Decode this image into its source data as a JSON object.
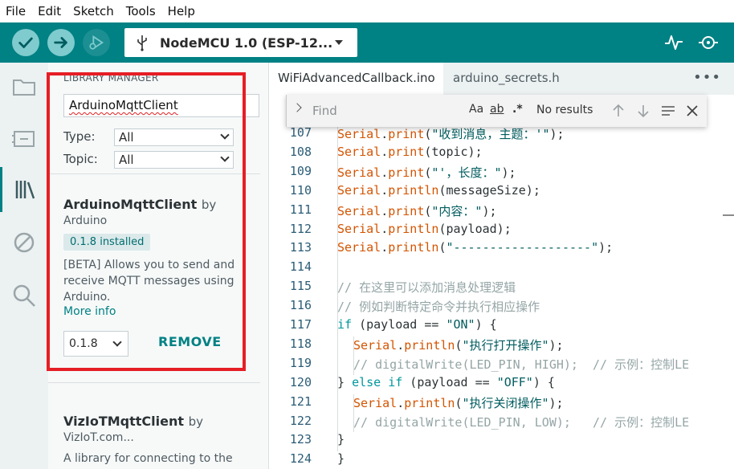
{
  "menu": [
    "File",
    "Edit",
    "Sketch",
    "Tools",
    "Help"
  ],
  "toolbar": {
    "board": "NodeMCU 1.0 (ESP-12...",
    "colors": {
      "bar": "#008184",
      "button": "#7fcbcd"
    }
  },
  "library": {
    "title": "LIBRARY MANAGER",
    "search_value": "ArduinoMqttClient",
    "type_label": "Type:",
    "type_value": "All",
    "topic_label": "Topic:",
    "topic_value": "All",
    "items": [
      {
        "name": "ArduinoMqttClient",
        "by": "by",
        "author": "Arduino",
        "installed": "0.1.8 installed",
        "description": "[BETA] Allows you to send and receive MQTT messages using Arduino.",
        "more_info": "More info",
        "version": "0.1.8",
        "action": "REMOVE"
      },
      {
        "name": "VizIoTMqttClient",
        "by": "by",
        "author": "VizIoT.com...",
        "description": "A library for connecting to the"
      }
    ]
  },
  "tabs": [
    {
      "label": "WiFiAdvancedCallback.ino",
      "active": true
    },
    {
      "label": "arduino_secrets.h",
      "active": false
    }
  ],
  "find": {
    "placeholder": "Find",
    "match_case": "Aa",
    "whole_word": "ab",
    "regex": ".*",
    "results": "No results"
  },
  "code": {
    "lines": [
      {
        "n": "107",
        "indent": 1,
        "parts": [
          [
            "fn",
            "Serial"
          ],
          [
            "p",
            "."
          ],
          [
            "fn",
            "print"
          ],
          [
            "p",
            "("
          ],
          [
            "str",
            "\"收到消息，主题：'\""
          ],
          [
            "p",
            ");"
          ]
        ]
      },
      {
        "n": "108",
        "indent": 1,
        "parts": [
          [
            "fn",
            "Serial"
          ],
          [
            "p",
            "."
          ],
          [
            "fn",
            "print"
          ],
          [
            "p",
            "(topic);"
          ]
        ]
      },
      {
        "n": "109",
        "indent": 1,
        "parts": [
          [
            "fn",
            "Serial"
          ],
          [
            "p",
            "."
          ],
          [
            "fn",
            "print"
          ],
          [
            "p",
            "("
          ],
          [
            "str",
            "\"'，长度：\""
          ],
          [
            "p",
            ");"
          ]
        ]
      },
      {
        "n": "110",
        "indent": 1,
        "parts": [
          [
            "fn",
            "Serial"
          ],
          [
            "p",
            "."
          ],
          [
            "fn",
            "println"
          ],
          [
            "p",
            "(messageSize);"
          ]
        ]
      },
      {
        "n": "111",
        "indent": 1,
        "parts": [
          [
            "fn",
            "Serial"
          ],
          [
            "p",
            "."
          ],
          [
            "fn",
            "print"
          ],
          [
            "p",
            "("
          ],
          [
            "str",
            "\"内容：\""
          ],
          [
            "p",
            ");"
          ]
        ]
      },
      {
        "n": "112",
        "indent": 1,
        "parts": [
          [
            "fn",
            "Serial"
          ],
          [
            "p",
            "."
          ],
          [
            "fn",
            "println"
          ],
          [
            "p",
            "(payload);"
          ]
        ]
      },
      {
        "n": "113",
        "indent": 1,
        "parts": [
          [
            "fn",
            "Serial"
          ],
          [
            "p",
            "."
          ],
          [
            "fn",
            "println"
          ],
          [
            "p",
            "("
          ],
          [
            "str",
            "\"-------------------\""
          ],
          [
            "p",
            ");"
          ]
        ]
      },
      {
        "n": "114",
        "indent": 1,
        "parts": []
      },
      {
        "n": "115",
        "indent": 1,
        "parts": [
          [
            "cm",
            "// 在这里可以添加消息处理逻辑"
          ]
        ]
      },
      {
        "n": "116",
        "indent": 1,
        "parts": [
          [
            "cm",
            "// 例如判断特定命令并执行相应操作"
          ]
        ]
      },
      {
        "n": "117",
        "indent": 1,
        "parts": [
          [
            "kw",
            "if"
          ],
          [
            "p",
            " (payload == "
          ],
          [
            "str",
            "\"ON\""
          ],
          [
            "p",
            ") {"
          ]
        ]
      },
      {
        "n": "118",
        "indent": 2,
        "parts": [
          [
            "fn",
            "Serial"
          ],
          [
            "p",
            "."
          ],
          [
            "fn",
            "println"
          ],
          [
            "p",
            "("
          ],
          [
            "str",
            "\"执行打开操作\""
          ],
          [
            "p",
            ");"
          ]
        ]
      },
      {
        "n": "119",
        "indent": 2,
        "parts": [
          [
            "cm",
            "// digitalWrite(LED_PIN, HIGH);  // 示例：控制LE"
          ]
        ]
      },
      {
        "n": "120",
        "indent": 1,
        "parts": [
          [
            "p",
            "} "
          ],
          [
            "kw",
            "else if"
          ],
          [
            "p",
            " (payload == "
          ],
          [
            "str",
            "\"OFF\""
          ],
          [
            "p",
            ") {"
          ]
        ]
      },
      {
        "n": "121",
        "indent": 2,
        "parts": [
          [
            "fn",
            "Serial"
          ],
          [
            "p",
            "."
          ],
          [
            "fn",
            "println"
          ],
          [
            "p",
            "("
          ],
          [
            "str",
            "\"执行关闭操作\""
          ],
          [
            "p",
            ");"
          ]
        ]
      },
      {
        "n": "122",
        "indent": 2,
        "parts": [
          [
            "cm",
            "// digitalWrite(LED_PIN, LOW);   // 示例：控制LE"
          ]
        ]
      },
      {
        "n": "123",
        "indent": 1,
        "parts": [
          [
            "p",
            "}"
          ]
        ]
      },
      {
        "n": "124",
        "indent": 0,
        "parts": [
          [
            "p",
            "}"
          ]
        ]
      }
    ]
  }
}
